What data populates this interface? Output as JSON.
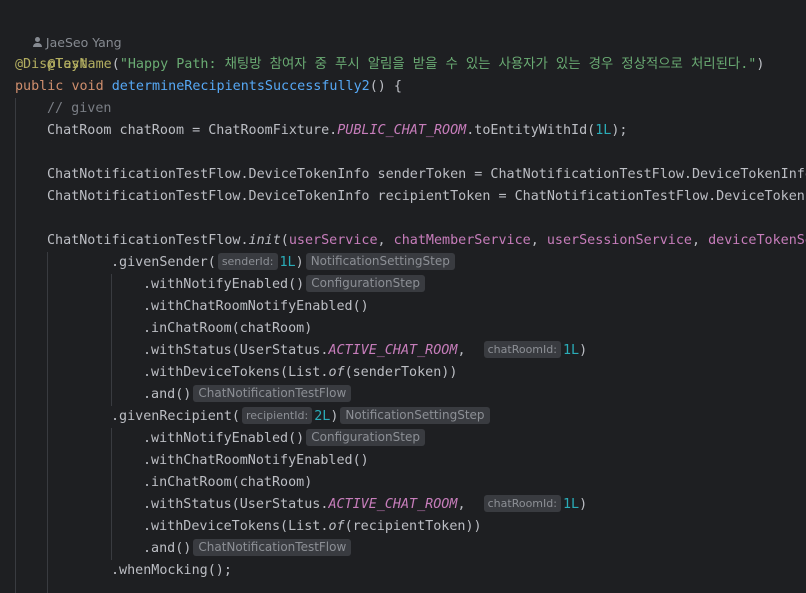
{
  "editor": {
    "author": "JaeSeo Yang",
    "lines": {
      "annotation_test": "@Test",
      "annotation_display": "@DisplayName",
      "display_open": "(",
      "display_string": "\"Happy Path: 채팅방 참여자 중 푸시 알림을 받을 수 있는 사용자가 있는 경우 정상적으로 처리된다.\"",
      "display_close": ")",
      "kw_public": "public",
      "kw_void": "void",
      "method_name": "determineRecipientsSuccessfully2",
      "method_tail": "() {",
      "comment_given": "// given",
      "chatroom_decl": "ChatRoom chatRoom = ChatRoomFixture.",
      "chatroom_const": "PUBLIC_CHAT_ROOM",
      "chatroom_call": ".toEntityWithId(",
      "chatroom_num": "1L",
      "chatroom_end": ");",
      "sender_token_line": "ChatNotificationTestFlow.DeviceTokenInfo senderToken = ChatNotificationTestFlow.DeviceTokenInfo",
      "recipient_token_line": "ChatNotificationTestFlow.DeviceTokenInfo recipientToken = ChatNotificationTestFlow.DeviceTokenI",
      "init_prefix": "ChatNotificationTestFlow.",
      "init_method": "init",
      "init_open": "(",
      "init_arg1": "userService",
      "init_arg2": "chatMemberService",
      "init_arg3": "userSessionService",
      "init_arg4": "deviceTokenSe",
      "comma": ", ",
      "given_sender": ".givenSender(",
      "hint_sender_id": "senderId:",
      "num_1l": "1L",
      "close_paren": ")",
      "hint_notification_setting_step": "NotificationSettingStep",
      "with_notify_enabled": ".withNotifyEnabled()",
      "hint_configuration_step": "ConfigurationStep",
      "with_chatroom_notify_enabled": ".withChatRoomNotifyEnabled()",
      "in_chatroom": ".inChatRoom(chatRoom)",
      "with_status": ".withStatus(UserStatus.",
      "active_chat_room": "ACTIVE_CHAT_ROOM",
      "comma_plain": ",",
      "hint_chatroom_id": "chatRoomId:",
      "with_device_tokens_open": ".withDeviceTokens(List.",
      "of_method": "of",
      "sender_token_arg": "(senderToken))",
      "recipient_token_arg": "(recipientToken))",
      "and_call": ".and()",
      "hint_chat_notification_test_flow": "ChatNotificationTestFlow",
      "given_recipient": ".givenRecipient(",
      "hint_recipient_id": "recipientId:",
      "num_2l": "2L",
      "when_mocking": ".whenMocking();"
    }
  }
}
